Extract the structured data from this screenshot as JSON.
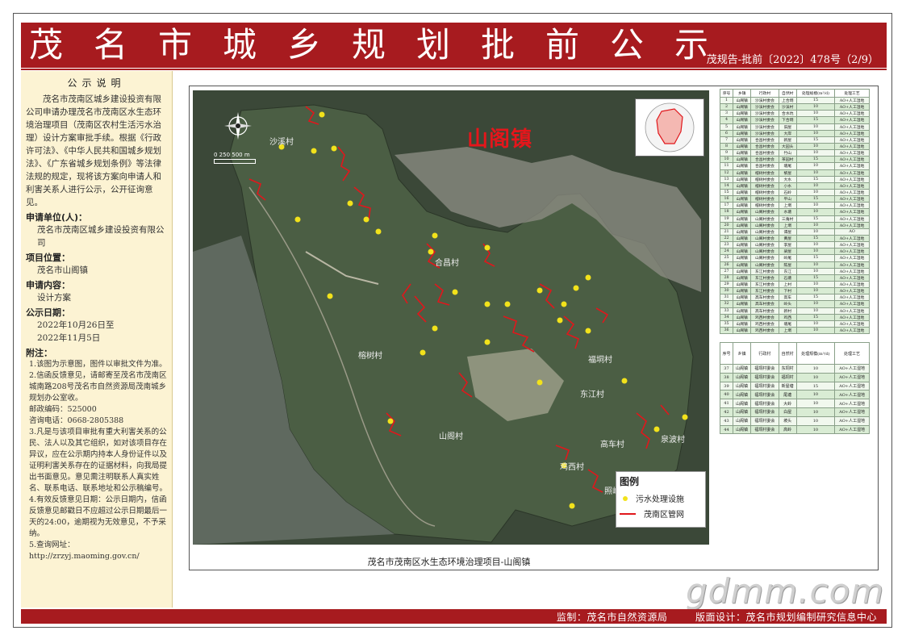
{
  "header": {
    "title": "茂名市城乡规划批前公示",
    "code": "茂规告-批前〔2022〕478号（2/9）"
  },
  "sidebar": {
    "title": "公示说明",
    "intro": "茂名市茂南区城乡建设投资有限公司申请办理茂名市茂南区水生态环境治理项目（茂南区农村生活污水治理）设计方案审批手续。根据《行政许可法》、《中华人民共和国城乡规划法》、《广东省城乡规划条例》等法律法规的规定，现将该方案向申请人和利害关系人进行公示，公开征询意见。",
    "applicant_label": "申请单位(人)：",
    "applicant_value": "茂名市茂南区城乡建设投资有限公司",
    "location_label": "项目位置：",
    "location_value": "茂名市山阁镇",
    "content_label": "申请内容：",
    "content_value": "设计方案",
    "date_label": "公示日期：",
    "date_from": "2022年10月26日至",
    "date_to": "2022年11月5日",
    "notes_label": "附注：",
    "notes": [
      "1.该图为示意图，图件以审批文件为准。",
      "2.信函反馈意见，请邮寄至茂名市茂南区城南路208号茂名市自然资源局茂南城乡规划办公室收。",
      "邮政编码：525000",
      "咨询电话：0668-2805388",
      "3.凡是与该项目审批有重大利害关系的公民、法人以及其它组织，如对该项目存在异议，应在公示期内持本人身份证件以及证明利害关系存在的证据材料，向我局提出书面意见。意见需注明联系人真实姓名、联系电话、联系地址和公示稿编号。",
      "4.有效反馈意见日期：公示日期内，信函反馈意见邮戳日不应超过公示日期最后一天的24:00，逾期视为无效意见，不予采纳。",
      "5.查询网址：",
      "http://zrzyj.maoming.gov.cn/"
    ]
  },
  "map": {
    "town_label": "山阁镇",
    "villages": [
      "沙溪村",
      "合昌村",
      "榕树村",
      "福垌村",
      "山阁村",
      "东江村",
      "高车村",
      "鸡西村",
      "照岭村",
      "泉波村"
    ],
    "legend_title": "图例",
    "legend_facility": "污水处理设施",
    "legend_pipe": "茂南区管网",
    "scale_text": "0 250 500 m",
    "caption": "茂名市茂南区水生态环境治理项目-山阁镇",
    "colors": {
      "facility": "#f2e21b",
      "pipe": "#e0171c",
      "label": "#e5161b"
    }
  },
  "table1": {
    "headers": [
      "序号",
      "乡镇",
      "行政村",
      "自然村",
      "处理规模(m³/d)",
      "处理工艺"
    ],
    "rows": [
      [
        "1",
        "山阁镇",
        "沙溪村委会",
        "上合垌",
        "15",
        "AO+人工湿地"
      ],
      [
        "2",
        "山阁镇",
        "沙溪村委会",
        "沙溪村",
        "10",
        "AO+人工湿地"
      ],
      [
        "3",
        "山阁镇",
        "沙溪村委会",
        "合水坑",
        "10",
        "AO+人工湿地"
      ],
      [
        "4",
        "山阁镇",
        "沙溪村委会",
        "下合垌",
        "15",
        "AO+人工湿地"
      ],
      [
        "5",
        "山阁镇",
        "沙溪村委会",
        "旧屋",
        "10",
        "AO+人工湿地"
      ],
      [
        "6",
        "山阁镇",
        "沙溪村委会",
        "大岸",
        "10",
        "AO+人工湿地"
      ],
      [
        "7",
        "山阁镇",
        "合昌村委会",
        "新屋",
        "15",
        "AO+人工湿地"
      ],
      [
        "8",
        "山阁镇",
        "合昌村委会",
        "大园头",
        "10",
        "AO+人工湿地"
      ],
      [
        "9",
        "山阁镇",
        "合昌村委会",
        "竹山",
        "10",
        "AO+人工湿地"
      ],
      [
        "10",
        "山阁镇",
        "合昌村委会",
        "茶园村",
        "15",
        "AO+人工湿地"
      ],
      [
        "11",
        "山阁镇",
        "合昌村委会",
        "塘尾",
        "10",
        "AO+人工湿地"
      ],
      [
        "12",
        "山阁镇",
        "榕树村委会",
        "黎屋",
        "10",
        "AO+人工湿地"
      ],
      [
        "13",
        "山阁镇",
        "榕树村委会",
        "大水",
        "15",
        "AO+人工湿地"
      ],
      [
        "14",
        "山阁镇",
        "榕树村委会",
        "小水",
        "10",
        "AO+人工湿地"
      ],
      [
        "15",
        "山阁镇",
        "榕树村委会",
        "石岭",
        "10",
        "AO+人工湿地"
      ],
      [
        "16",
        "山阁镇",
        "榕树村委会",
        "平山",
        "15",
        "AO+人工湿地"
      ],
      [
        "17",
        "山阁镇",
        "榕树村委会",
        "上垌",
        "10",
        "AO+人工湿地"
      ],
      [
        "18",
        "山阁镇",
        "山阁村委会",
        "水塘",
        "10",
        "AO+人工湿地"
      ],
      [
        "19",
        "山阁镇",
        "山阁村委会",
        "三角村",
        "15",
        "AO+人工湿地"
      ],
      [
        "20",
        "山阁镇",
        "山阁村委会",
        "上垌",
        "10",
        "AO+人工湿地"
      ],
      [
        "21",
        "山阁镇",
        "山阁村委会",
        "谭屋",
        "10",
        "AO"
      ],
      [
        "22",
        "山阁镇",
        "山阁村委会",
        "黄屋",
        "15",
        "AO+人工湿地"
      ],
      [
        "23",
        "山阁镇",
        "山阁村委会",
        "李屋",
        "10",
        "AO+人工湿地"
      ],
      [
        "24",
        "山阁镇",
        "山阁村委会",
        "梁屋",
        "10",
        "AO+人工湿地"
      ],
      [
        "25",
        "山阁镇",
        "山阁村委会",
        "岭尾",
        "15",
        "AO+人工湿地"
      ],
      [
        "26",
        "山阁镇",
        "山阁村委会",
        "陈屋",
        "10",
        "AO+人工湿地"
      ],
      [
        "27",
        "山阁镇",
        "东江村委会",
        "东江",
        "10",
        "AO+人工湿地"
      ],
      [
        "28",
        "山阁镇",
        "东江村委会",
        "石塘",
        "15",
        "AO+人工湿地"
      ],
      [
        "29",
        "山阁镇",
        "东江村委会",
        "上村",
        "10",
        "AO+人工湿地"
      ],
      [
        "30",
        "山阁镇",
        "东江村委会",
        "下村",
        "10",
        "AO+人工湿地"
      ],
      [
        "31",
        "山阁镇",
        "高车村委会",
        "高车",
        "15",
        "AO+人工湿地"
      ],
      [
        "32",
        "山阁镇",
        "高车村委会",
        "岭头",
        "10",
        "AO+人工湿地"
      ],
      [
        "33",
        "山阁镇",
        "高车村委会",
        "新村",
        "10",
        "AO+人工湿地"
      ],
      [
        "34",
        "山阁镇",
        "鸡西村委会",
        "鸡西",
        "15",
        "AO+人工湿地"
      ],
      [
        "35",
        "山阁镇",
        "鸡西村委会",
        "塘尾",
        "10",
        "AO+人工湿地"
      ],
      [
        "36",
        "山阁镇",
        "鸡西村委会",
        "上垌",
        "10",
        "AO+人工湿地"
      ]
    ]
  },
  "table2": {
    "headers": [
      "序号",
      "乡镇",
      "行政村",
      "自然村",
      "处理规模(m³/d)",
      "处理工艺"
    ],
    "rows": [
      [
        "37",
        "山阁镇",
        "福垌村委会",
        "东垌村",
        "10",
        "AO+人工湿地"
      ],
      [
        "38",
        "山阁镇",
        "福垌村委会",
        "福垌村",
        "10",
        "AO+人工湿地"
      ],
      [
        "39",
        "山阁镇",
        "福垌村委会",
        "新屋塘",
        "15",
        "AO+人工湿地"
      ],
      [
        "40",
        "山阁镇",
        "福垌村委会",
        "尾塘",
        "10",
        "AO+人工湿地"
      ],
      [
        "41",
        "山阁镇",
        "福垌村委会",
        "大岭",
        "10",
        "AO+人工湿地"
      ],
      [
        "42",
        "山阁镇",
        "福垌村委会",
        "白屋",
        "10",
        "AO+人工湿地"
      ],
      [
        "43",
        "山阁镇",
        "福垌村委会",
        "坡头",
        "10",
        "AO+人工湿地"
      ],
      [
        "44",
        "山阁镇",
        "福垌村委会",
        "高岭",
        "10",
        "AO+人工湿地"
      ]
    ]
  },
  "watermark": "gdmm.com",
  "footer": {
    "supervise": "监制：茂名市自然资源局",
    "design": "版面设计：茂名市规划编制研究信息中心"
  }
}
